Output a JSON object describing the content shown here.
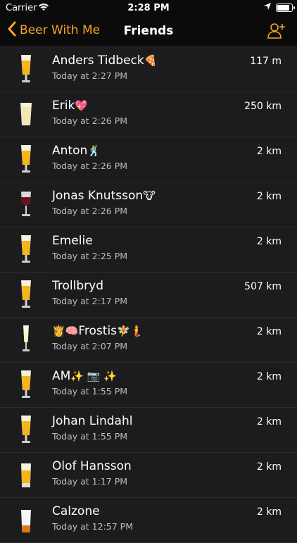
{
  "status_bar": {
    "carrier": "Carrier",
    "time": "2:28 PM"
  },
  "nav": {
    "back_label": "Beer With Me",
    "title": "Friends"
  },
  "colors": {
    "accent": "#f5a623",
    "background": "#1c1c1e",
    "separator": "#2c2c2e"
  },
  "friends": [
    {
      "name": "Anders Tidbeck",
      "emoji": "🍕",
      "time": "Today at 2:27 PM",
      "distance": "117 m",
      "drink": "lager-glass-icon"
    },
    {
      "name": "Erik",
      "emoji": "💖",
      "time": "Today at 2:26 PM",
      "distance": "250 km",
      "drink": "wheat-beer-icon"
    },
    {
      "name": "Anton",
      "emoji": "🕺",
      "time": "Today at 2:26 PM",
      "distance": "2 km",
      "drink": "lager-glass-icon"
    },
    {
      "name": "Jonas Knutsson",
      "emoji": "🐮",
      "time": "Today at 2:26 PM",
      "distance": "2 km",
      "drink": "wine-glass-icon"
    },
    {
      "name": "Emelie",
      "emoji": "",
      "time": "Today at 2:25 PM",
      "distance": "2 km",
      "drink": "lager-glass-icon"
    },
    {
      "name": "Trollbryd",
      "emoji": "",
      "time": "Today at 2:17 PM",
      "distance": "507 km",
      "drink": "lager-glass-icon"
    },
    {
      "name": "Frostis",
      "emoji_prefix": "👸🧠",
      "emoji": "🧚🧜",
      "time": "Today at 2:07 PM",
      "distance": "2 km",
      "drink": "champagne-glass-icon"
    },
    {
      "name": "AM",
      "emoji": "✨ 📷 ✨",
      "time": "Today at 1:55 PM",
      "distance": "2 km",
      "drink": "lager-glass-icon"
    },
    {
      "name": "Johan Lindahl",
      "emoji": "",
      "time": "Today at 1:55 PM",
      "distance": "2 km",
      "drink": "lager-glass-icon"
    },
    {
      "name": "Olof Hansson",
      "emoji": "",
      "time": "Today at 1:17 PM",
      "distance": "2 km",
      "drink": "pint-glass-icon"
    },
    {
      "name": "Calzone",
      "emoji": "",
      "time": "Today at 12:57 PM",
      "distance": "2 km",
      "drink": "shot-glass-icon"
    }
  ]
}
